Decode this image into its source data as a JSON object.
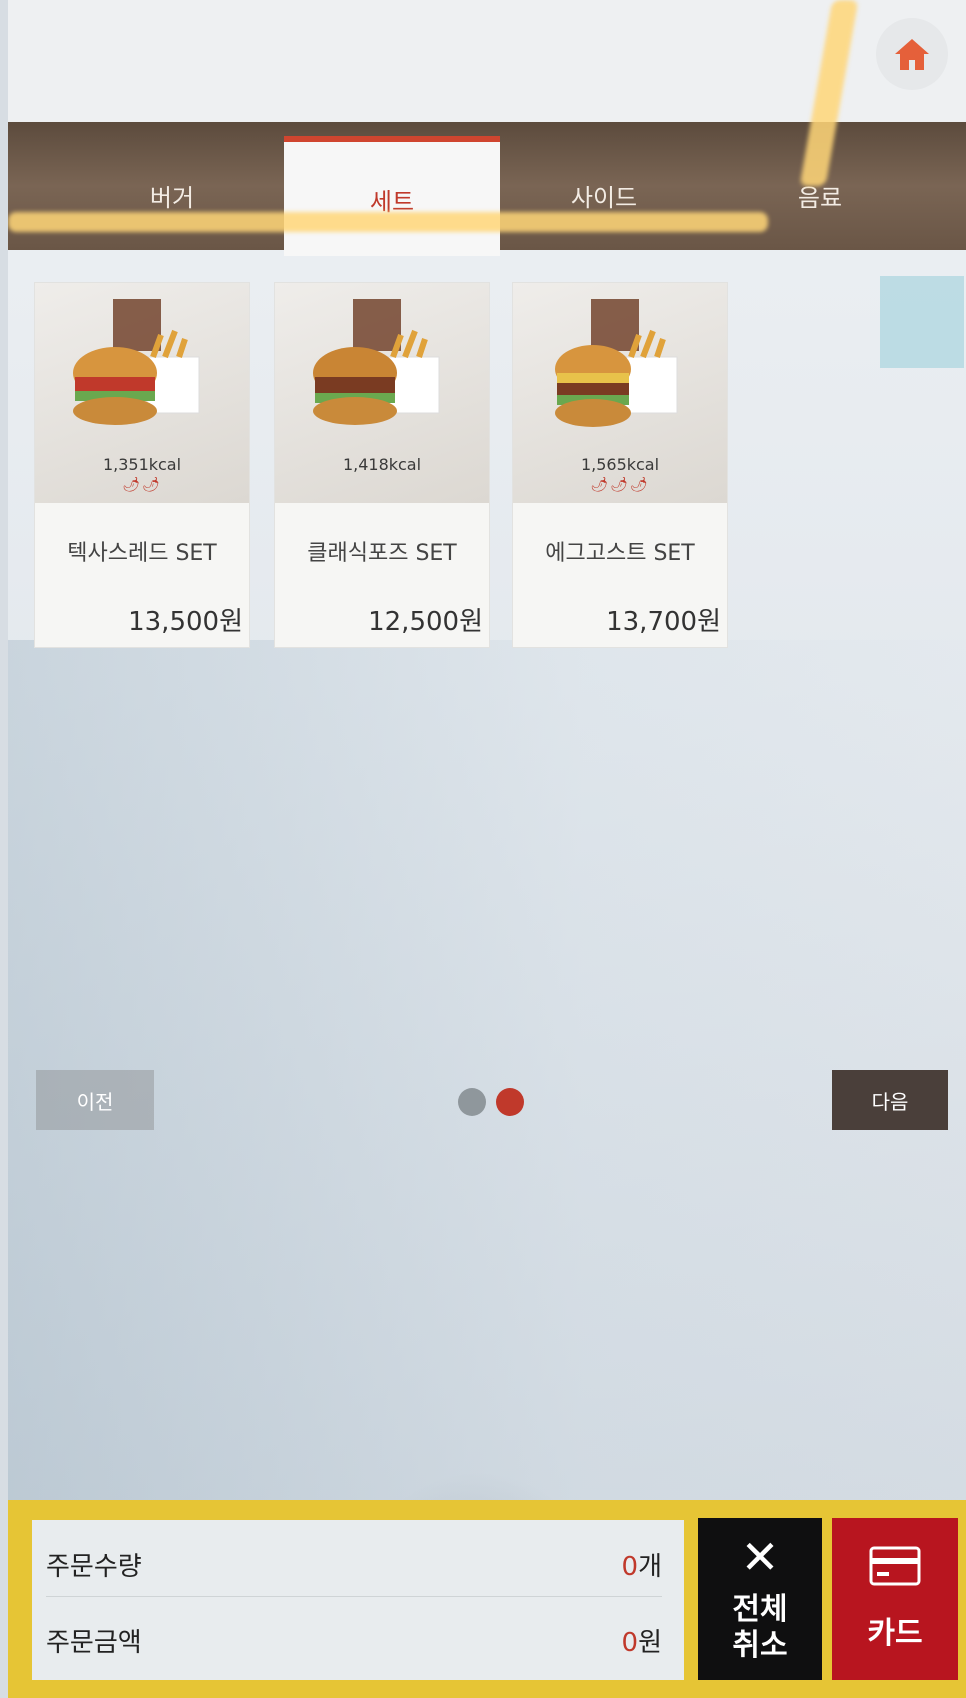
{
  "tabs": [
    {
      "label": "버거"
    },
    {
      "label": "세트"
    },
    {
      "label": "사이드"
    },
    {
      "label": "음료"
    }
  ],
  "active_tab": "세트",
  "menu_items": [
    {
      "name": "텍사스레드 SET",
      "kcal": "1,351kcal",
      "price": "13,500원",
      "spice_level": 2
    },
    {
      "name": "클래식포즈 SET",
      "kcal": "1,418kcal",
      "price": "12,500원",
      "spice_level": 0
    },
    {
      "name": "에그고스트 SET",
      "kcal": "1,565kcal",
      "price": "13,700원",
      "spice_level": 3
    }
  ],
  "pagination": {
    "prev_label": "이전",
    "next_label": "다음",
    "page": 2,
    "pages": 2
  },
  "order": {
    "qty_label": "주문수량",
    "qty_value": "0",
    "qty_unit": "개",
    "amount_label": "주문금액",
    "amount_value": "0",
    "amount_unit": "원"
  },
  "buttons": {
    "cancel_label": "전체\n취소",
    "card_label": "카드"
  },
  "colors": {
    "accent": "#c0392b",
    "tab_bar": "#6a5646",
    "bottom_bar": "#e6c535",
    "card_button": "#b8151f"
  }
}
